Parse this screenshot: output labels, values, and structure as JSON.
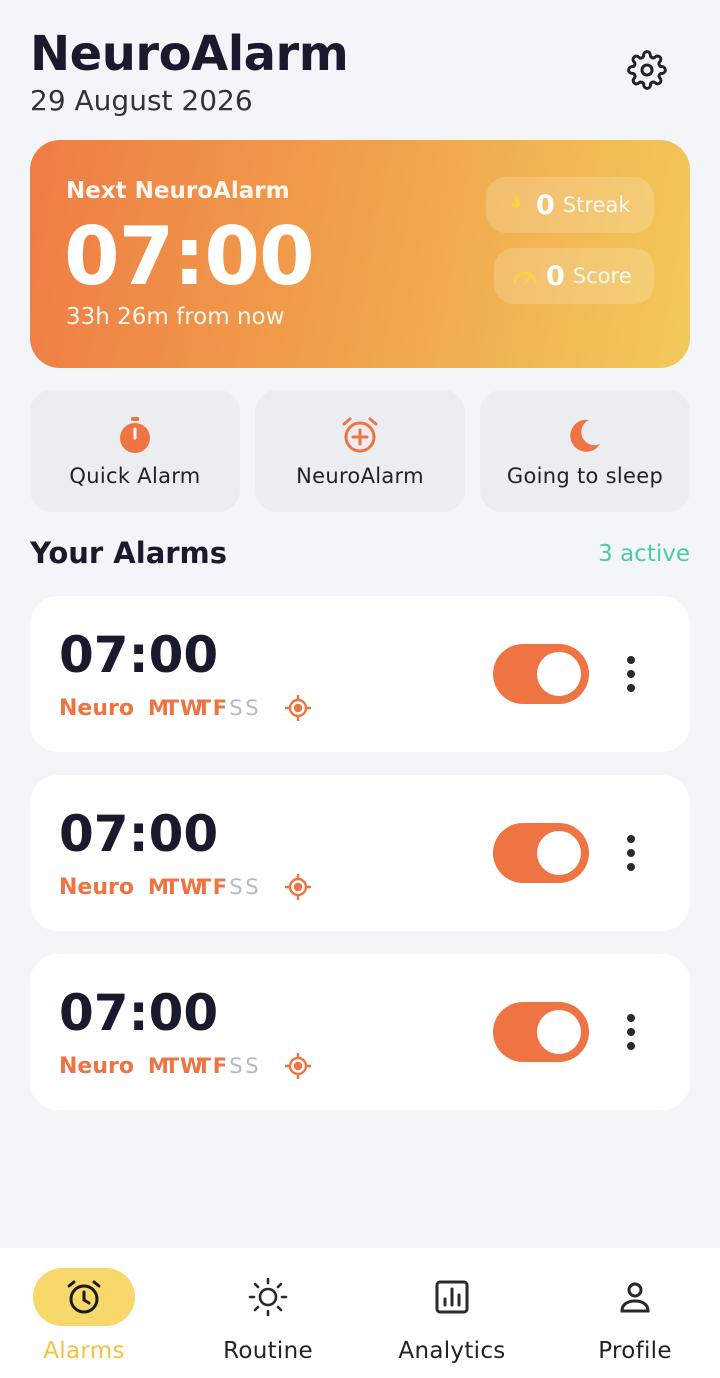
{
  "header": {
    "title": "NeuroAlarm",
    "date": "29 August 2026",
    "settings_icon": "gear-icon"
  },
  "next_alarm": {
    "label": "Next NeuroAlarm",
    "time": "07:00",
    "countdown": "33h 26m from now",
    "streak_value": "0",
    "streak_label": "Streak",
    "score_value": "0",
    "score_label": "Score"
  },
  "quick_actions": [
    {
      "label": "Quick Alarm",
      "icon": "stopwatch-icon"
    },
    {
      "label": "NeuroAlarm",
      "icon": "alarm-add-icon"
    },
    {
      "label": "Going to sleep",
      "icon": "moon-icon"
    }
  ],
  "alarms_section": {
    "title": "Your Alarms",
    "count": "3 active"
  },
  "alarms": [
    {
      "time": "07:00",
      "type": "Neuro",
      "days": [
        "M",
        "T",
        "W",
        "T",
        "F",
        "S",
        "S"
      ],
      "enabled": true
    },
    {
      "time": "07:00",
      "type": "Neuro",
      "days": [
        "M",
        "T",
        "W",
        "T",
        "F",
        "S",
        "S"
      ],
      "enabled": true
    },
    {
      "time": "07:00",
      "type": "Neuro",
      "days": [
        "M",
        "T",
        "W",
        "T",
        "F",
        "S",
        "S"
      ],
      "enabled": true
    }
  ],
  "bottom_nav": [
    {
      "label": "Alarms",
      "icon": "alarm-clock-icon",
      "active": true
    },
    {
      "label": "Routine",
      "icon": "sun-icon",
      "active": false
    },
    {
      "label": "Analytics",
      "icon": "chart-icon",
      "active": false
    },
    {
      "label": "Profile",
      "icon": "person-icon",
      "active": false
    }
  ],
  "colors": {
    "accent": "#ee7444",
    "active_count": "#4dcba3",
    "nav_active": "#f8d76b"
  }
}
